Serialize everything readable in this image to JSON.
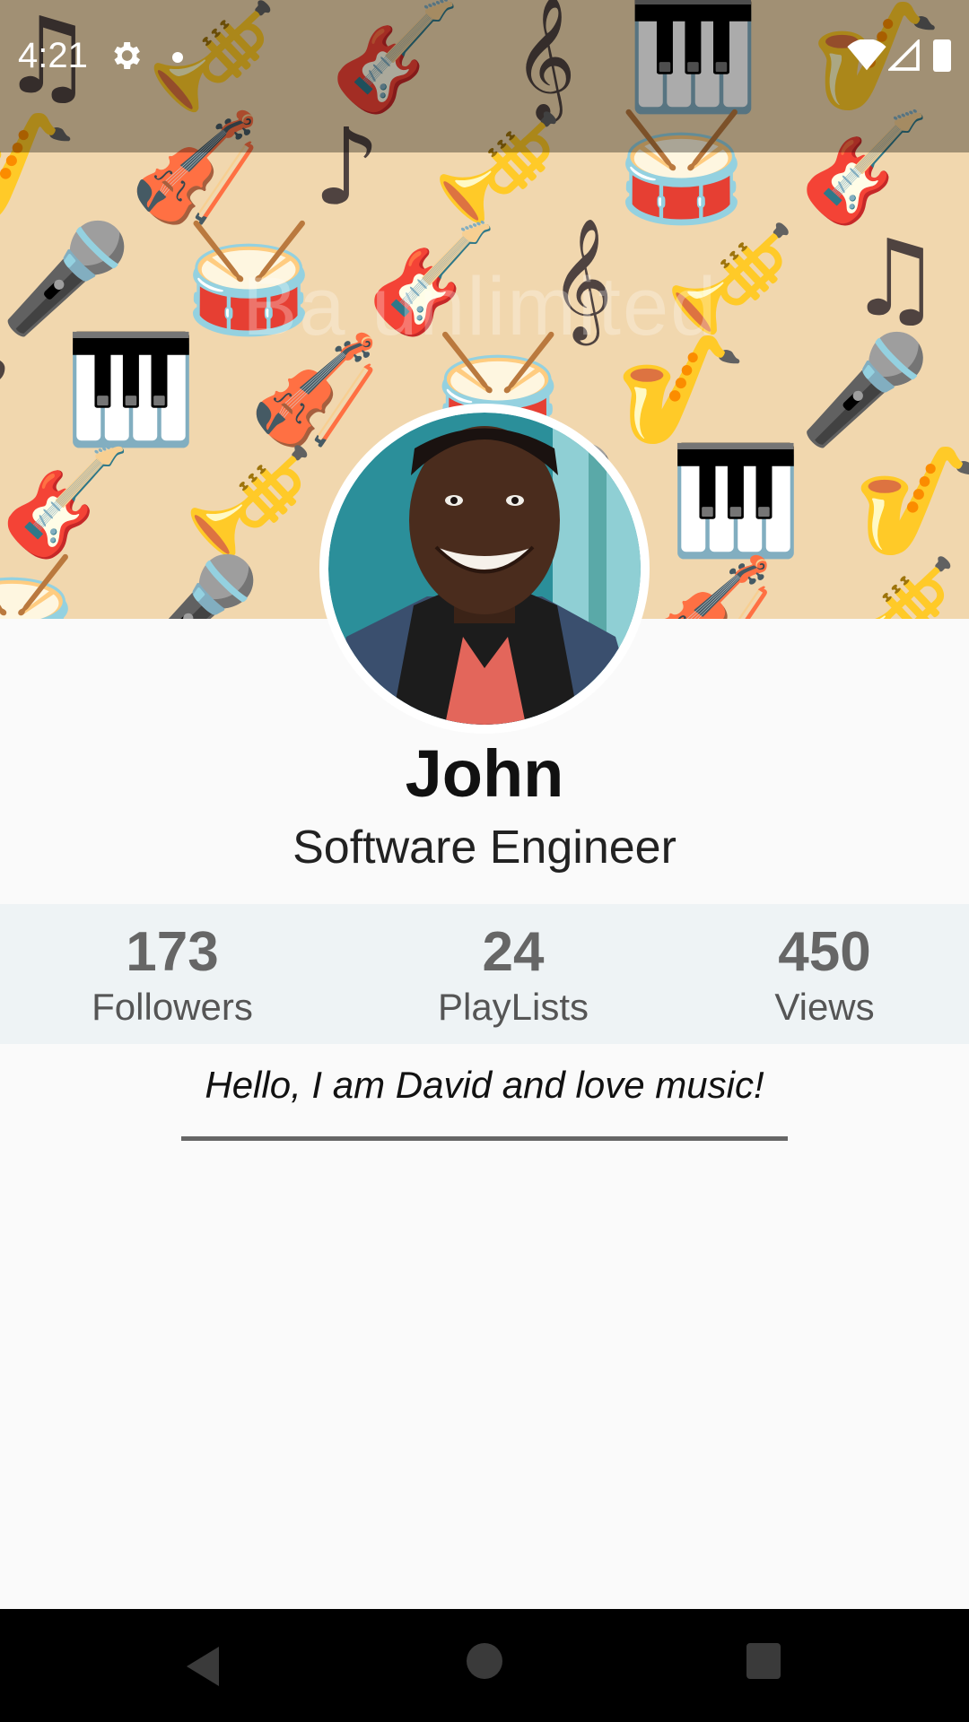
{
  "status_bar": {
    "time": "4:21",
    "icons": [
      "gear-icon",
      "notification-dot-icon",
      "wifi-icon",
      "signal-icon",
      "battery-icon"
    ]
  },
  "header": {
    "banner_icons": [
      "guitar-icon",
      "trumpet-icon",
      "saxophone-icon",
      "piano-icon",
      "drum-icon",
      "microphone-icon",
      "violin-icon",
      "music-note-icon",
      "bass-clef-icon",
      "treble-clef-icon"
    ],
    "watermark": "Ba unlimited"
  },
  "profile": {
    "name": "John",
    "title": "Software Engineer",
    "avatar_icon": "profile-photo"
  },
  "stats": {
    "followers": {
      "value": "173",
      "label": "Followers"
    },
    "playlists": {
      "value": "24",
      "label": "PlayLists"
    },
    "views": {
      "value": "450",
      "label": "Views"
    }
  },
  "bio": {
    "text": "Hello, I am David and love music!"
  },
  "nav_bar": {
    "icons": [
      "back-icon",
      "home-icon",
      "recents-icon"
    ]
  },
  "colors": {
    "banner_bg": "#f1d7ae",
    "banner_icon": "#4f4340",
    "stats_bg": "#eef3f5",
    "stat_number": "#666666",
    "page_bg": "#fafafa"
  }
}
